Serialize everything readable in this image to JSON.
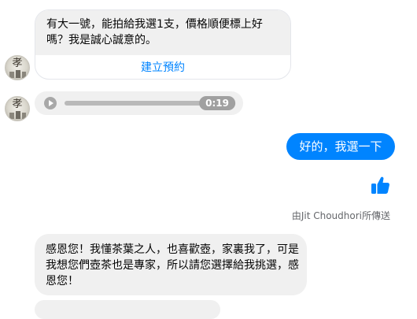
{
  "messages": {
    "card": {
      "text": "有大一號，能拍給我選1支，價格順便標上好嗎？我是誠心誠意的。",
      "action_label": "建立預約"
    },
    "audio": {
      "duration": "0:19"
    },
    "outgoing": {
      "text": "好的，我選一下"
    },
    "seen": {
      "prefix": "由",
      "name": "Jit Choudhori",
      "suffix": "所傳送"
    },
    "incoming2": {
      "text": "感恩您！我懂茶葉之人，也喜歡壺，家裏我了，可是我想您們壺茶也是專家，所以請您選擇給我挑選，感恩您！"
    }
  },
  "colors": {
    "accent": "#0084ff",
    "bubble_gray": "#f0f0f0",
    "meta_text": "#65676b"
  },
  "icons": {
    "like": "thumbs-up-icon",
    "play": "play-icon"
  }
}
